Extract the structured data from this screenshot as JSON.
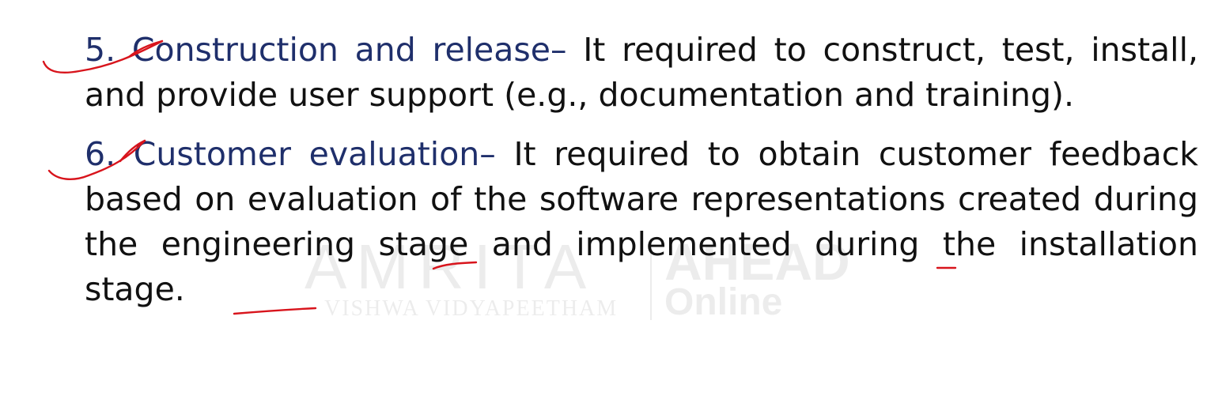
{
  "watermark": {
    "main": "AMRITA",
    "sub": "VISHWA VIDYAPEETHAM",
    "right_top": "AHEAD",
    "right_bottom": "Online"
  },
  "items": [
    {
      "number": "5.",
      "heading": "Construction and release",
      "dash": "–",
      "body": " It required to construct, test, install, and provide user support (e.g., documentation and training)."
    },
    {
      "number": "6.",
      "heading": "Customer evaluation",
      "dash": "–",
      "body": " It required to obtain customer feedback based on evaluation of the software representations created during the engineering stage and implemented during the installation stage."
    }
  ],
  "colors": {
    "heading": "#1f2f6b",
    "body": "#111111",
    "annotation": "#d8141c"
  }
}
